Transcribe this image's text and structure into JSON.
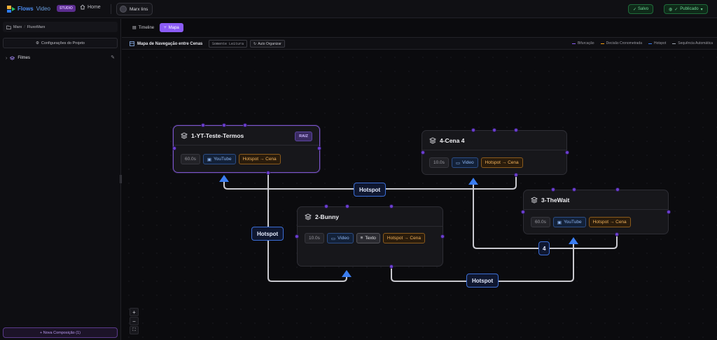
{
  "app": {
    "brand_part1": "Flows",
    "brand_part2": "Video",
    "studio_badge": "STUDIO",
    "home_label": "Home",
    "user_name": "Marx Iins",
    "saved_label": "Salvo",
    "publish_label": "Publicado"
  },
  "sidebar": {
    "breadcrumb": [
      "Marx",
      "FluxoMarx"
    ],
    "config_button": "Configurações do Projeto",
    "tree_items": [
      {
        "label": "Filmes"
      }
    ],
    "new_composition": "+ Nova Composição (1)"
  },
  "tabs": [
    {
      "label": "Timeline",
      "active": false
    },
    {
      "label": "Mapa",
      "active": true
    }
  ],
  "map_header": {
    "title": "Mapa de Navegação entre Cenas",
    "readonly_badge": "Somente Leitura",
    "auto_organize": "Auto Organizar",
    "legend": [
      {
        "label": "Bifurcação",
        "color": "#8b5cf6"
      },
      {
        "label": "Decisão Cronometrada",
        "color": "#f59e0b"
      },
      {
        "label": "Hotspot",
        "color": "#3b82f6"
      },
      {
        "label": "Sequência Automática",
        "color": "#9ca3af"
      }
    ]
  },
  "nodes": [
    {
      "id": "n1",
      "title": "1-YT-Teste-Termos",
      "badge": "RAIZ",
      "duration": "60.0s",
      "media": "YouTube",
      "text_chip": "",
      "hotspot": "Hotspot → Cena"
    },
    {
      "id": "n4",
      "title": "4-Cena 4",
      "badge": "",
      "duration": "10.0s",
      "media": "Video",
      "text_chip": "",
      "hotspot": "Hotspot → Cena"
    },
    {
      "id": "n2",
      "title": "2-Bunny",
      "badge": "",
      "duration": "10.0s",
      "media": "Video",
      "text_chip": "Texto",
      "hotspot": "Hotspot → Cena"
    },
    {
      "id": "n3",
      "title": "3-TheWait",
      "badge": "",
      "duration": "60.0s",
      "media": "YouTube",
      "text_chip": "",
      "hotspot": "Hotspot → Cena"
    }
  ],
  "edge_labels": [
    "Hotspot",
    "Hotspot",
    "Hotspot",
    "4"
  ],
  "colors": {
    "accent": "#8b5cf6",
    "edge_arrow": "#3b7df0",
    "hotspot_chip": "#f2b25b",
    "media_chip": "#8fb7f4",
    "success": "#6fd896"
  }
}
